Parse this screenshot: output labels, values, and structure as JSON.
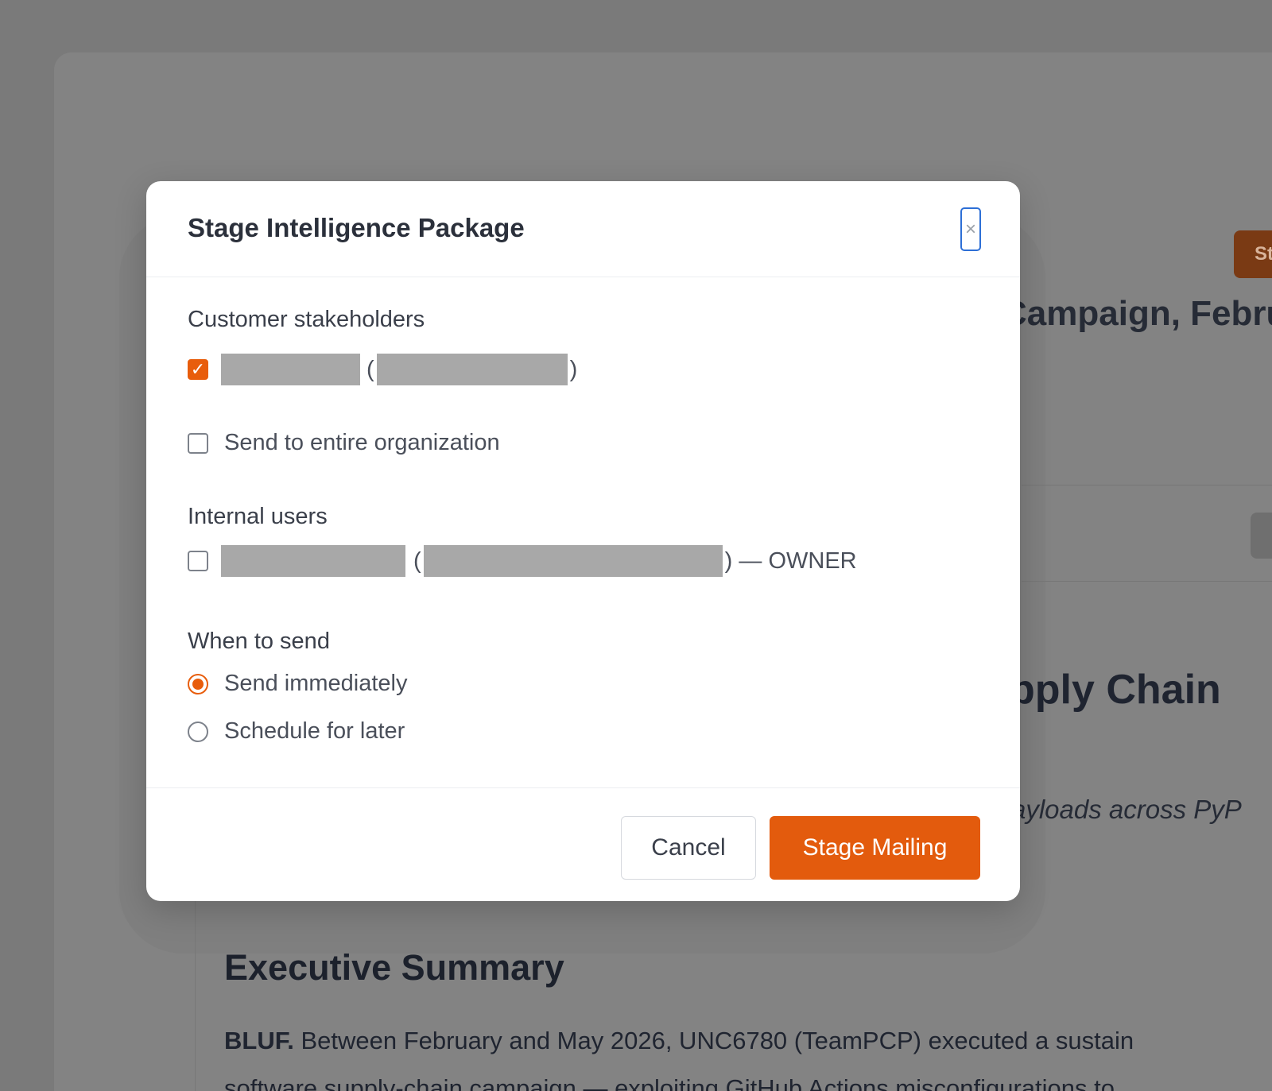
{
  "background": {
    "stage_button_label": "St",
    "campaign_heading": "Campaign, Febru",
    "supply_chain_heading": "pply Chain",
    "payloads_text": "ayloads across PyP",
    "executive_summary_heading": "Executive Summary",
    "bluf_label": "BLUF.",
    "bluf_line1": " Between February and May 2026, UNC6780 (TeamPCP) executed a sustain",
    "bluf_line2": "software supply-chain campaign — exploiting GitHub Actions misconfigurations to"
  },
  "modal": {
    "title": "Stage Intelligence Package",
    "close_glyph": "×",
    "customer_section_label": "Customer stakeholders",
    "customer_row": {
      "checked": true,
      "open_paren": "(",
      "close_paren": ")"
    },
    "send_org_label": "Send to entire organization",
    "internal_section_label": "Internal users",
    "internal_row": {
      "checked": false,
      "open_paren": "(",
      "suffix": ") — OWNER"
    },
    "when_section_label": "When to send",
    "send_options": [
      {
        "label": "Send immediately",
        "selected": true
      },
      {
        "label": "Schedule for later",
        "selected": false
      }
    ],
    "cancel_label": "Cancel",
    "stage_label": "Stage Mailing"
  },
  "colors": {
    "accent": "#e35b0d",
    "focus_ring": "#2d6fd6",
    "redaction": "#a8a8a8"
  }
}
